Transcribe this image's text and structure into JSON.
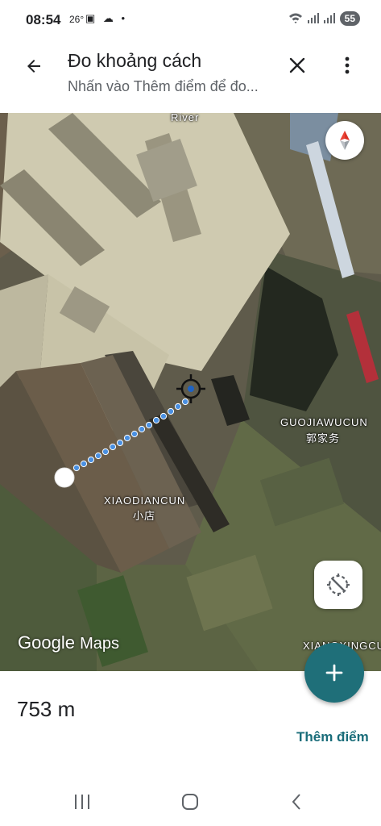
{
  "status_bar": {
    "time": "08:54",
    "temperature": "26°",
    "notification_icons": "▣ ☁ •",
    "battery": "55"
  },
  "header": {
    "title": "Đo khoảng cách",
    "subtitle": "Nhấn vào Thêm điểm để đo..."
  },
  "map": {
    "labels": {
      "river": "River",
      "guojiawucun_latin": "GUOJIAWUCUN",
      "guojiawucun_chinese": "郭家务",
      "xiaodiancun_latin": "XIAODIANCUN",
      "xiaodiancun_chinese": "小店",
      "xiangxingcun_latin": "XIANGXINGCUN"
    },
    "logo_google": "Google",
    "logo_maps": "Maps"
  },
  "measurement": {
    "distance": "753 m",
    "add_point_label": "Thêm điểm"
  },
  "colors": {
    "accent": "#1f6f79",
    "link": "#1a6d7a",
    "measure_line": "#4a90e2"
  },
  "icons": {
    "back": "arrow-left",
    "close": "x",
    "more": "vertical-dots",
    "compass": "compass-needle",
    "location": "location-off",
    "add": "plus",
    "crosshair": "target",
    "nav_recents": "three-bars",
    "nav_home": "rounded-square",
    "nav_back": "chevron-left"
  }
}
